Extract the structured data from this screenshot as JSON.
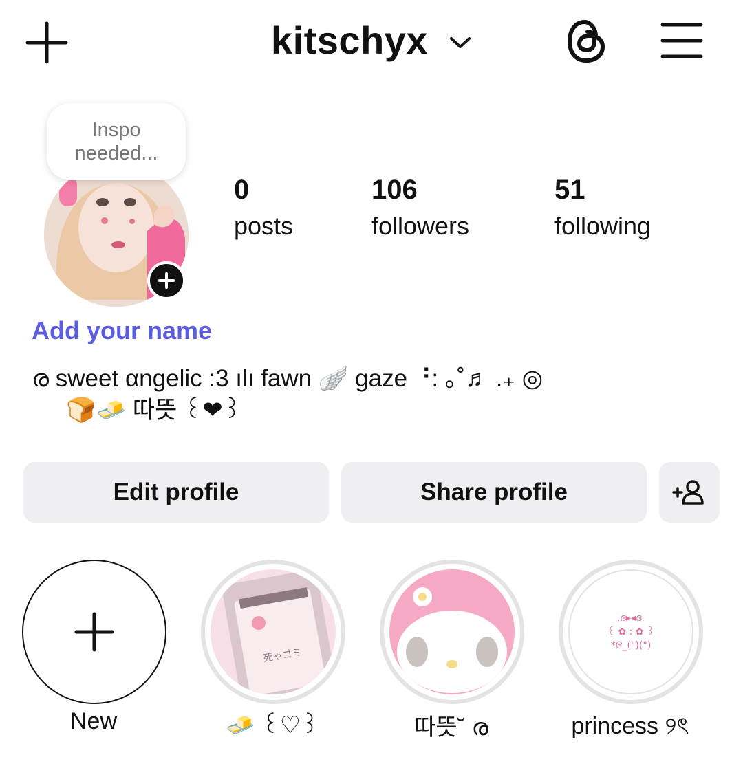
{
  "header": {
    "username": "kitschyx"
  },
  "note": {
    "line1": "Inspo",
    "line2": "needed..."
  },
  "stats": {
    "posts": {
      "value": "0",
      "label": "posts"
    },
    "followers": {
      "value": "106",
      "label": "followers"
    },
    "following": {
      "value": "51",
      "label": "following"
    }
  },
  "profile": {
    "add_name": "Add your name",
    "bio_line1": "ര sweet αngelic :3 ılı fawn 🪽 gaze ⠘: ｡˚♬ .₊ ◎",
    "bio_line2": "🍞🧈  따뜻  ꒰❤꒱"
  },
  "buttons": {
    "edit": "Edit profile",
    "share": "Share profile"
  },
  "highlights": [
    {
      "label": "New"
    },
    {
      "label": "🧈 ꒰♡꒱"
    },
    {
      "label": "따뜻˘ ര"
    },
    {
      "label": "princess ୨ৎ"
    }
  ],
  "highlight_3_text": {
    "l1": ",ദ▸◂ദ,",
    "l2": "꒰ ✿ : ✿ ꒱",
    "l3": "*ᘓ_(\")(\")"
  },
  "highlight_1_text": "死ゃゴミ",
  "colors": {
    "accent": "#5b5ce0",
    "button_bg": "#efeff2",
    "ring": "#e3e3e6"
  }
}
